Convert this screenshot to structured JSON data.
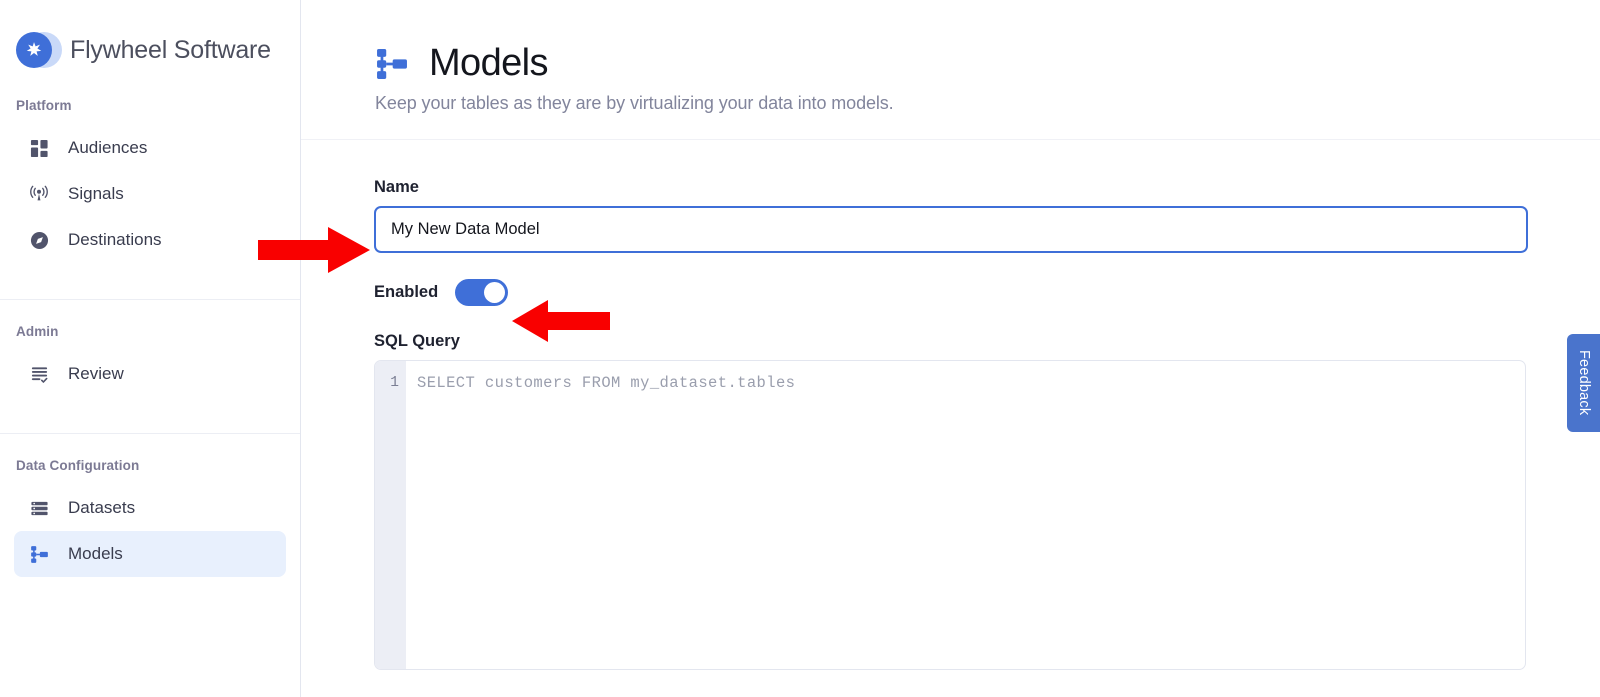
{
  "brand": {
    "name": "Flywheel Software",
    "logo_icon": "sparkle-star-icon"
  },
  "sidebar": {
    "sections": [
      {
        "label": "Platform",
        "items": [
          {
            "label": "Audiences",
            "icon": "grid-dashboard-icon",
            "active": false
          },
          {
            "label": "Signals",
            "icon": "broadcast-antenna-icon",
            "active": false
          },
          {
            "label": "Destinations",
            "icon": "compass-icon",
            "active": false
          }
        ]
      },
      {
        "label": "Admin",
        "items": [
          {
            "label": "Review",
            "icon": "checklist-icon",
            "active": false
          }
        ]
      },
      {
        "label": "Data Configuration",
        "items": [
          {
            "label": "Datasets",
            "icon": "database-rows-icon",
            "active": false
          },
          {
            "label": "Models",
            "icon": "sitemap-icon",
            "active": true
          }
        ]
      }
    ]
  },
  "page": {
    "icon": "sitemap-icon",
    "title": "Models",
    "subtitle": "Keep your tables as they are by virtualizing your data into models."
  },
  "form": {
    "name": {
      "label": "Name",
      "value": "My New Data Model",
      "placeholder": "Name"
    },
    "enabled": {
      "label": "Enabled",
      "state": "on"
    },
    "sql": {
      "label": "SQL Query",
      "line_number": "1",
      "code": "SELECT customers FROM my_dataset.tables"
    }
  },
  "feedback": {
    "label": "Feedback"
  },
  "annotations": {
    "arrow_color": "#f90000",
    "arrow_name_field": "points-right-at-name-input",
    "arrow_enabled_toggle": "points-left-at-enabled-toggle"
  },
  "colors": {
    "accent": "#3f6fd8",
    "active_nav_bg": "#e8f0fd",
    "section_label": "#7c7a94",
    "subtitle": "#82859c",
    "gutter_bg": "#eceef5",
    "feedback_bg": "#4a74cc"
  }
}
